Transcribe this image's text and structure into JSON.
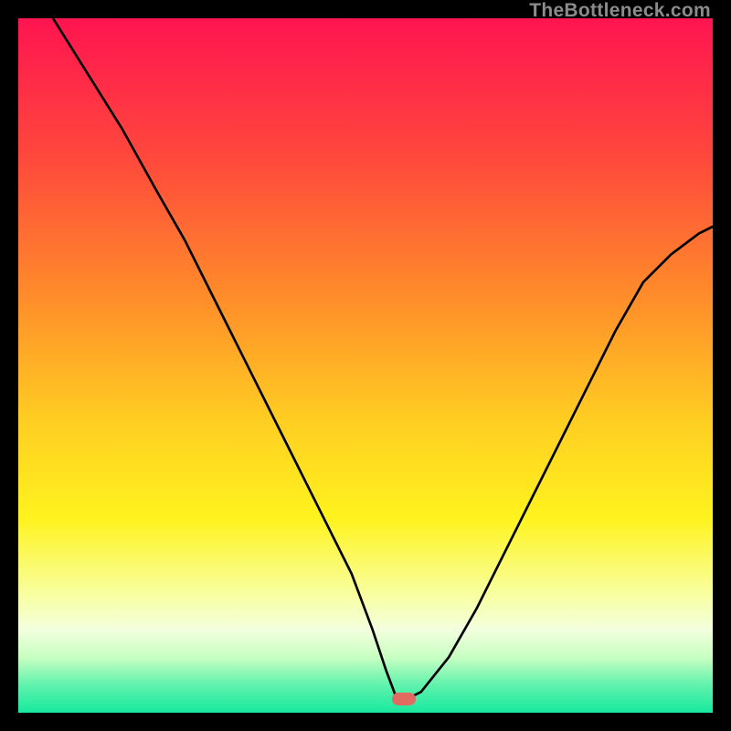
{
  "watermark": "TheBottleneck.com",
  "colors": {
    "page_bg": "#000000",
    "curve": "#000000",
    "marker": "#e26b61",
    "gradient_stops": [
      {
        "offset": 0.0,
        "color": "#ff1450"
      },
      {
        "offset": 0.2,
        "color": "#ff483c"
      },
      {
        "offset": 0.4,
        "color": "#ff8c2a"
      },
      {
        "offset": 0.58,
        "color": "#ffce22"
      },
      {
        "offset": 0.72,
        "color": "#fff31e"
      },
      {
        "offset": 0.83,
        "color": "#f8ffa0"
      },
      {
        "offset": 0.88,
        "color": "#f3ffde"
      },
      {
        "offset": 0.92,
        "color": "#c8ffc2"
      },
      {
        "offset": 0.96,
        "color": "#61f2ad"
      },
      {
        "offset": 1.0,
        "color": "#17e99e"
      }
    ]
  },
  "chart_data": {
    "type": "line",
    "title": "",
    "xlabel": "",
    "ylabel": "",
    "xlim": [
      0,
      100
    ],
    "ylim": [
      0,
      100
    ],
    "grid": false,
    "marker": {
      "x": 55.5,
      "y": 2
    },
    "series": [
      {
        "name": "bottleneck-curve",
        "x": [
          5,
          10,
          15,
          20,
          24,
          28,
          32,
          36,
          40,
          44,
          48,
          51,
          53,
          54.5,
          56,
          58,
          62,
          66,
          70,
          74,
          78,
          82,
          86,
          90,
          94,
          98,
          100
        ],
        "y": [
          100,
          92,
          84,
          75,
          68,
          60,
          52,
          44,
          36,
          28,
          20,
          12,
          6,
          2,
          2,
          3,
          8,
          15,
          23,
          31,
          39,
          47,
          55,
          62,
          66,
          69,
          70
        ]
      }
    ]
  }
}
